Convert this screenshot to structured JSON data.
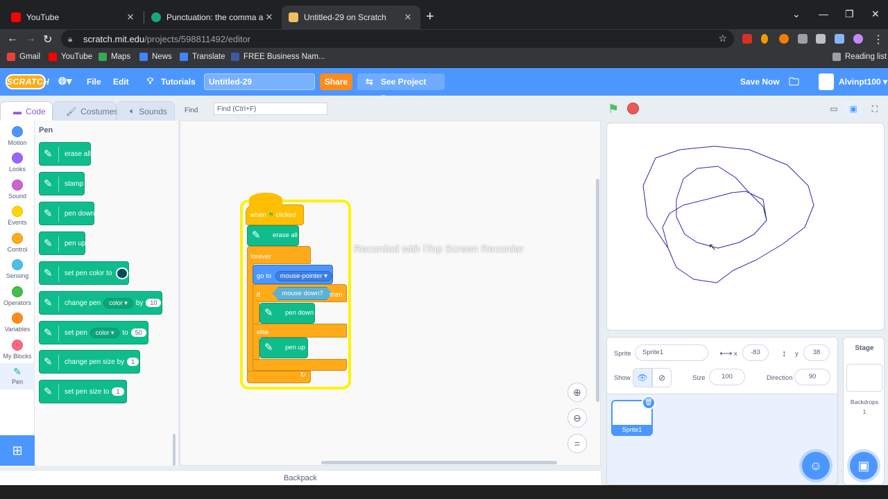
{
  "browser": {
    "tabs": [
      {
        "title": "YouTube",
        "color": "#ff0000"
      },
      {
        "title": "Punctuation: the comma and the",
        "color": "#1aa67a"
      },
      {
        "title": "Untitled-29 on Scratch",
        "color": "#f0c060"
      }
    ],
    "url_host": "scratch.mit.edu",
    "url_path": "/projects/598811492/editor",
    "bookmarks": [
      {
        "label": "Gmail",
        "color": "#ea4335"
      },
      {
        "label": "YouTube",
        "color": "#ff0000"
      },
      {
        "label": "Maps",
        "color": "#34a853"
      },
      {
        "label": "News",
        "color": "#4285f4"
      },
      {
        "label": "Translate",
        "color": "#4285f4"
      },
      {
        "label": "FREE Business Nam...",
        "color": "#3b5ba5"
      }
    ],
    "reading_list": "Reading list"
  },
  "menubar": {
    "logo": "SCRATCH",
    "file": "File",
    "edit": "Edit",
    "tutorials": "Tutorials",
    "project_title": "Untitled-29",
    "share": "Share",
    "see_project": "See Project Page",
    "save_now": "Save Now",
    "username": "Alvinpt100"
  },
  "editor_tabs": {
    "code": "Code",
    "costumes": "Costumes",
    "sounds": "Sounds"
  },
  "find": {
    "label": "Find",
    "placeholder": "Find (Ctrl+F)"
  },
  "categories": [
    {
      "label": "Motion",
      "color": "#4c97ff"
    },
    {
      "label": "Looks",
      "color": "#9966ff"
    },
    {
      "label": "Sound",
      "color": "#cf63cf"
    },
    {
      "label": "Events",
      "color": "#ffd500"
    },
    {
      "label": "Control",
      "color": "#ffab19"
    },
    {
      "label": "Sensing",
      "color": "#4cbfe6"
    },
    {
      "label": "Operators",
      "color": "#40bf4a"
    },
    {
      "label": "Variables",
      "color": "#ff8c1a"
    },
    {
      "label": "My Blocks",
      "color": "#ff6680"
    },
    {
      "label": "Pen",
      "color": "#0fbd8c"
    }
  ],
  "palette": {
    "heading": "Pen",
    "blocks": {
      "erase_all": "erase all",
      "stamp": "stamp",
      "pen_down": "pen down",
      "pen_up": "pen up",
      "set_pen_color": "set pen color to",
      "change_pen": "change pen",
      "change_param": "color",
      "by": "by",
      "change_value": "10",
      "set_pen": "set pen",
      "set_param": "color",
      "to": "to",
      "set_value": "50",
      "change_size": "change pen size by",
      "change_size_value": "1",
      "set_size": "set pen size to",
      "set_size_value": "1"
    }
  },
  "script": {
    "when": "when",
    "clicked": "clicked",
    "erase_all": "erase all",
    "forever": "forever",
    "go_to": "go to",
    "go_target": "mouse-pointer",
    "if": "if",
    "condition": "mouse down?",
    "then": "then",
    "pen_down": "pen down",
    "else": "else",
    "pen_up": "pen up"
  },
  "watermark": "Recorded with iTop Screen Recorder",
  "backpack": "Backpack",
  "sprite_info": {
    "sprite_label": "Sprite",
    "sprite_name": "Sprite1",
    "x_label": "x",
    "x_value": "-83",
    "y_label": "y",
    "y_value": "38",
    "show_label": "Show",
    "size_label": "Size",
    "size_value": "100",
    "direction_label": "Direction",
    "direction_value": "90"
  },
  "sprite_list": [
    {
      "name": "Sprite1"
    }
  ],
  "stage_pane": {
    "title": "Stage",
    "backdrops_label": "Backdrops",
    "backdrops_count": "1"
  },
  "drawing": {
    "stroke_color": "#2b2ba8"
  }
}
